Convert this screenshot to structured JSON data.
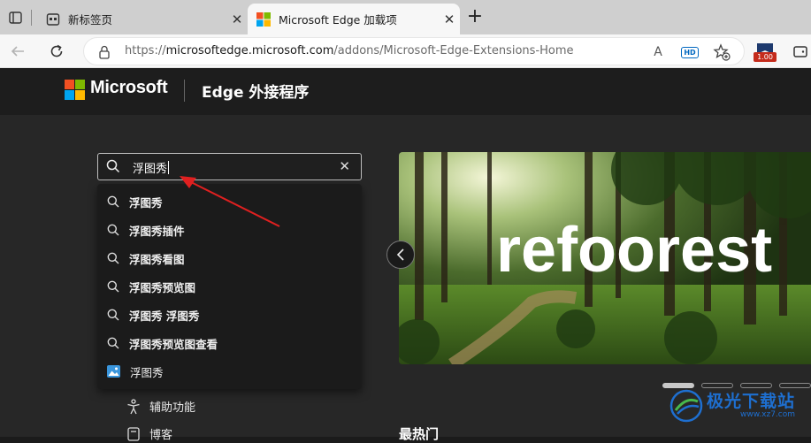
{
  "browser": {
    "tabs": [
      {
        "title": "新标签页",
        "active": false
      },
      {
        "title": "Microsoft Edge 加载项",
        "active": true
      }
    ],
    "url": "https://microsoftedge.microsoft.com/addons/Microsoft-Edge-Extensions-Home",
    "url_host": "microsoftedge.microsoft.com",
    "url_prefix": "https://",
    "url_path": "/addons/Microsoft-Edge-Extensions-Home",
    "read_aloud_label": "A",
    "hd_badge": "HD",
    "extension_badge": "1.00"
  },
  "site": {
    "brand": "Microsoft",
    "product": "Edge 外接程序"
  },
  "search": {
    "value": "浮图秀",
    "suggestions": [
      {
        "bold": "浮图秀",
        "rest": "",
        "kind": "query"
      },
      {
        "bold": "浮图秀插件",
        "rest": "",
        "kind": "query"
      },
      {
        "bold": "浮图秀看图",
        "rest": "",
        "kind": "query"
      },
      {
        "bold": "浮图秀预览图",
        "rest": "",
        "kind": "query"
      },
      {
        "bold": "浮图秀 浮图秀",
        "rest": "",
        "kind": "query"
      },
      {
        "bold": "浮图秀预览图查看",
        "rest": "",
        "kind": "query"
      },
      {
        "bold": "",
        "rest": "浮图秀",
        "kind": "extension"
      }
    ]
  },
  "sidebar": {
    "items": [
      {
        "label": "辅助功能",
        "icon": "accessibility-icon"
      },
      {
        "label": "博客",
        "icon": "blog-icon"
      }
    ]
  },
  "carousel": {
    "banner_text": "refoorest",
    "slide_count": 4,
    "active_slide": 1
  },
  "sections": {
    "most_popular": "最热门"
  },
  "watermark": {
    "cn": "极光下载站",
    "en": "www.xz7.com"
  },
  "colors": {
    "arrow": "#e02020",
    "accent": "#0078d4"
  }
}
